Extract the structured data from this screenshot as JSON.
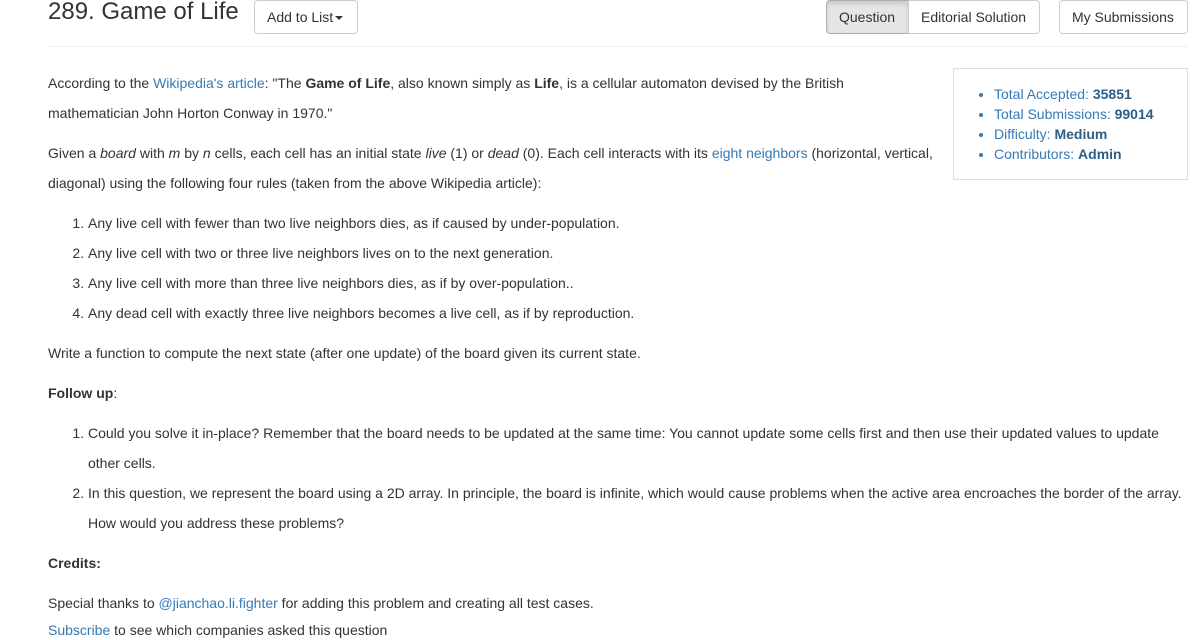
{
  "header": {
    "title": "289. Game of Life",
    "add_to_list": "Add to List",
    "tabs": [
      "Question",
      "Editorial Solution"
    ],
    "my_submissions": "My Submissions"
  },
  "stats": {
    "accepted_label": "Total Accepted:",
    "accepted_value": "35851",
    "submissions_label": "Total Submissions:",
    "submissions_value": "99014",
    "difficulty_label": "Difficulty:",
    "difficulty_value": "Medium",
    "contributors_label": "Contributors:",
    "contributors_value": "Admin"
  },
  "intro": {
    "prefix": "According to the ",
    "link": "Wikipedia's article",
    "part1": ": \"The ",
    "bold1": "Game of Life",
    "part2": ", also known simply as ",
    "bold2": "Life",
    "part3": ", is a cellular automaton devised by the British mathematician John Horton Conway in 1970.\""
  },
  "given": {
    "p1": "Given a ",
    "em_board": "board",
    "p2": " with ",
    "em_m": "m",
    "p3": " by ",
    "em_n": "n",
    "p4": " cells, each cell has an initial state ",
    "em_live": "live",
    "p5": " (1) or ",
    "em_dead": "dead",
    "p6": " (0). Each cell interacts with its ",
    "link": "eight neighbors",
    "p7": " (horizontal, vertical, diagonal) using the following four rules (taken from the above Wikipedia article):"
  },
  "rules": [
    "Any live cell with fewer than two live neighbors dies, as if caused by under-population.",
    "Any live cell with two or three live neighbors lives on to the next generation.",
    "Any live cell with more than three live neighbors dies, as if by over-population..",
    "Any dead cell with exactly three live neighbors becomes a live cell, as if by reproduction."
  ],
  "task": "Write a function to compute the next state (after one update) of the board given its current state.",
  "followup": {
    "label": "Follow up",
    "colon": ":",
    "items": [
      "Could you solve it in-place? Remember that the board needs to be updated at the same time: You cannot update some cells first and then use their updated values to update other cells.",
      "In this question, we represent the board using a 2D array. In principle, the board is infinite, which would cause problems when the active area encroaches the border of the array. How would you address these problems?"
    ]
  },
  "credits": {
    "label": "Credits:",
    "prefix": "Special thanks to ",
    "link": "@jianchao.li.fighter",
    "suffix": " for adding this problem and creating all test cases."
  },
  "subscribe": {
    "link": "Subscribe",
    "suffix": " to see which companies asked this question"
  },
  "colors": {
    "link": "#337ab7",
    "stat_value": "#2c5f88"
  }
}
